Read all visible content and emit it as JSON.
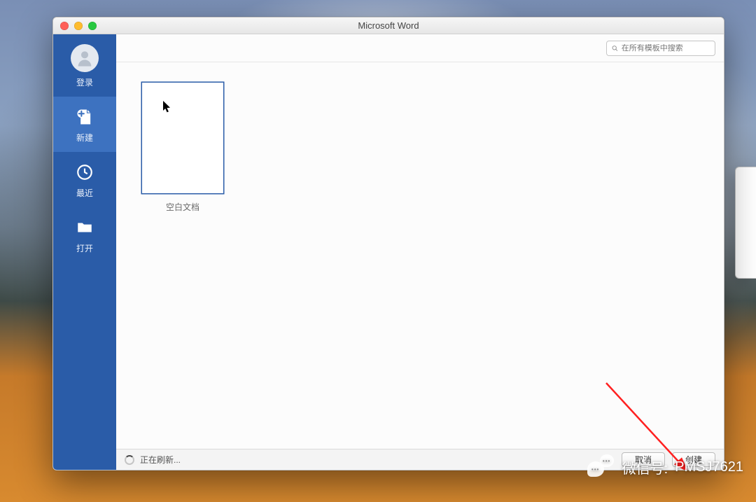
{
  "window": {
    "title": "Microsoft Word"
  },
  "sidebar": {
    "items": [
      {
        "id": "signin",
        "label": "登录"
      },
      {
        "id": "new",
        "label": "新建"
      },
      {
        "id": "recent",
        "label": "最近"
      },
      {
        "id": "open",
        "label": "打开"
      }
    ]
  },
  "search": {
    "placeholder": "在所有模板中搜索",
    "value": ""
  },
  "templates": [
    {
      "label": "空白文档",
      "selected": true
    }
  ],
  "status": {
    "text": "正在刷新..."
  },
  "buttons": {
    "cancel": "取消",
    "create": "创建"
  },
  "watermark": {
    "prefix": "微信号:",
    "id": "PMSJ7621"
  }
}
